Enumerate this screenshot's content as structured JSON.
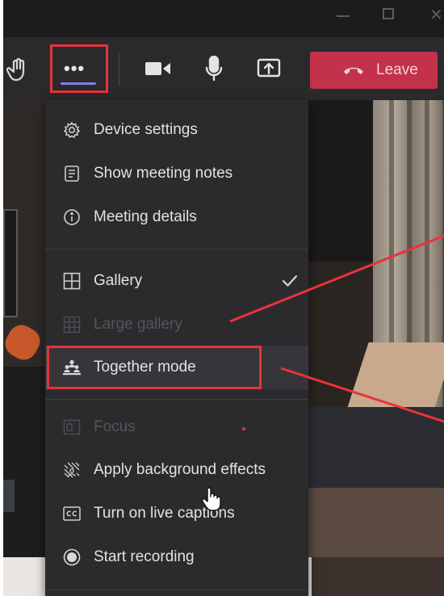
{
  "call_controls": {
    "more_options_glyph": "•••",
    "leave_label": "Leave",
    "icons": [
      "raise-hand-icon",
      "more-options-icon",
      "camera-icon",
      "microphone-icon",
      "share-screen-icon",
      "phone-hangup-icon"
    ]
  },
  "menu": {
    "items": [
      {
        "label": "Device settings",
        "icon": "gear-icon",
        "enabled": true
      },
      {
        "label": "Show meeting notes",
        "icon": "notes-icon",
        "enabled": true
      },
      {
        "label": "Meeting details",
        "icon": "info-icon",
        "enabled": true
      },
      {
        "label": "Gallery",
        "icon": "gallery-grid-icon",
        "enabled": true,
        "checked": true
      },
      {
        "label": "Large gallery",
        "icon": "large-gallery-grid-icon",
        "enabled": false
      },
      {
        "label": "Together mode",
        "icon": "together-mode-icon",
        "enabled": true,
        "highlighted": true
      },
      {
        "label": "Focus",
        "icon": "focus-icon",
        "enabled": false
      },
      {
        "label": "Apply background effects",
        "icon": "background-effects-icon",
        "enabled": true
      },
      {
        "label": "Turn on live captions",
        "icon": "captions-icon",
        "enabled": true
      },
      {
        "label": "Start recording",
        "icon": "record-icon",
        "enabled": true
      }
    ]
  },
  "colors": {
    "annotation_red": "#e8333b",
    "leave_button": "#c4314b",
    "menu_bg": "#2b2b2e",
    "accent_underline": "#7b83eb"
  }
}
